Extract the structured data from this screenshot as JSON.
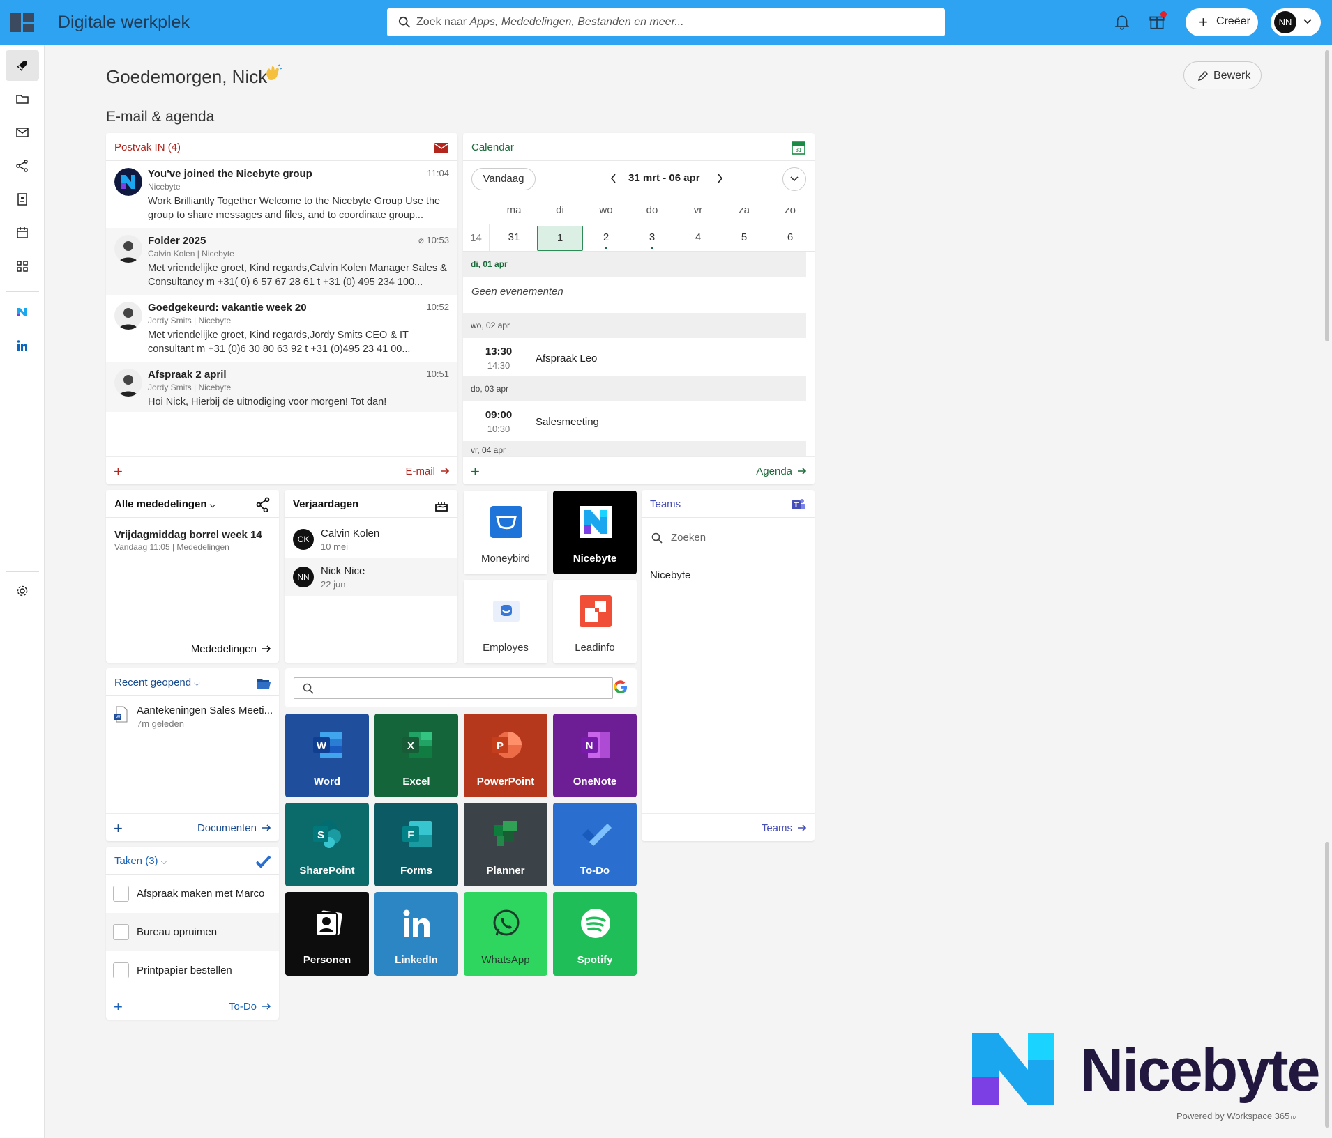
{
  "app": {
    "title": "Digitale werkplek",
    "search_prefix": "Zoek naar ",
    "search_italic": "Apps, Mededelingen, Bestanden en meer...",
    "create_label": "Creëer",
    "user_initials": "NN",
    "accent": "#2ea3f2"
  },
  "page": {
    "greeting": "Goedemorgen, Nick",
    "edit_label": "Bewerk",
    "section_title": "E-mail & agenda"
  },
  "inbox": {
    "title": "Postvak IN (4)",
    "color": "#b3261e",
    "footer_plus": "+",
    "footer_link": "E-mail",
    "items": [
      {
        "subject": "You've joined the Nicebyte group",
        "time": "11:04",
        "from": "Nicebyte",
        "body": "Work Brilliantly Together Welcome to the Nicebyte Group Use the group to share messages and files, and to coordinate group..."
      },
      {
        "subject": "Folder 2025",
        "time": "10:53",
        "from": "Calvin Kolen | Nicebyte",
        "body": "Met vriendelijke groet, Kind regards,Calvin Kolen Manager Sales & Consultancy m +31( 0) 6 57 67 28 61 t +31 (0) 495 234 100..."
      },
      {
        "subject": "Goedgekeurd: vakantie week 20",
        "time": "10:52",
        "from": "Jordy Smits | Nicebyte",
        "body": "Met vriendelijke groet, Kind regards,Jordy Smits CEO & IT consultant m +31 (0)6 30 80 63 92 t +31 (0)495 23 41 00..."
      },
      {
        "subject": "Afspraak 2 april",
        "time": "10:51",
        "from": "Jordy Smits | Nicebyte",
        "body": "Hoi Nick, Hierbij de uitnodiging voor morgen! Tot dan!"
      }
    ]
  },
  "calendar": {
    "title": "Calendar",
    "color": "#1b6a3a",
    "today_label": "Vandaag",
    "range": "31 mrt - 06 apr",
    "week_number": "14",
    "day_headers": [
      "ma",
      "di",
      "wo",
      "do",
      "vr",
      "za",
      "zo"
    ],
    "days": [
      "31",
      "1",
      "2",
      "3",
      "4",
      "5",
      "6"
    ],
    "date_1": "di, 01 apr",
    "no_events": "Geen evenementen",
    "date_2": "wo, 02 apr",
    "event_1": {
      "start": "13:30",
      "end": "14:30",
      "title": "Afspraak Leo"
    },
    "date_3": "do, 03 apr",
    "event_2": {
      "start": "09:00",
      "end": "10:30",
      "title": "Salesmeeting"
    },
    "date_4": "vr, 04 apr",
    "footer_plus": "+",
    "footer_link": "Agenda"
  },
  "announcements": {
    "title": "Alle mededelingen",
    "item_title": "Vrijdagmiddag borrel week 14",
    "item_meta": "Vandaag 11:05 | Mededelingen",
    "footer_link": "Mededelingen"
  },
  "birthdays": {
    "title": "Verjaardagen",
    "items": [
      {
        "initials": "CK",
        "name": "Calvin Kolen",
        "date": "10 mei"
      },
      {
        "initials": "NN",
        "name": "Nick Nice",
        "date": "22 jun"
      }
    ]
  },
  "quick_apps": [
    "Moneybird",
    "Nicebyte",
    "Employes",
    "Leadinfo"
  ],
  "teams": {
    "title": "Teams",
    "color": "#464eb8",
    "search_placeholder": "Zoeken",
    "team": "Nicebyte",
    "footer_link": "Teams"
  },
  "recent": {
    "title": "Recent geopend",
    "color": "#1a4d8f",
    "doc_name": "Aantekeningen Sales Meeti...",
    "doc_time": "7m geleden",
    "footer_plus": "+",
    "footer_link": "Documenten"
  },
  "tasks": {
    "title": "Taken (3)",
    "color": "#1a63b8",
    "items": [
      "Afspraak maken met Marco",
      "Bureau opruimen",
      "Printpapier bestellen"
    ],
    "footer_plus": "+",
    "footer_link": "To-Do"
  },
  "apps": [
    {
      "name": "Word",
      "color": "#1e4e9c"
    },
    {
      "name": "Excel",
      "color": "#15653a"
    },
    {
      "name": "PowerPoint",
      "color": "#b5381c"
    },
    {
      "name": "OneNote",
      "color": "#6e1e95"
    },
    {
      "name": "SharePoint",
      "color": "#0b6a6a"
    },
    {
      "name": "Forms",
      "color": "#0c5a63"
    },
    {
      "name": "Planner",
      "color": "#3b4248"
    },
    {
      "name": "To-Do",
      "color": "#2a6fd0"
    },
    {
      "name": "Personen",
      "color": "#0d0d0d"
    },
    {
      "name": "LinkedIn",
      "color": "#2d86c4"
    },
    {
      "name": "WhatsApp",
      "color": "#2ed660"
    },
    {
      "name": "Spotify",
      "color": "#1fbe58"
    }
  ],
  "brand": {
    "name": "Nicebyte",
    "powered": "Powered by Workspace 365",
    "powered_tm": "TM"
  }
}
